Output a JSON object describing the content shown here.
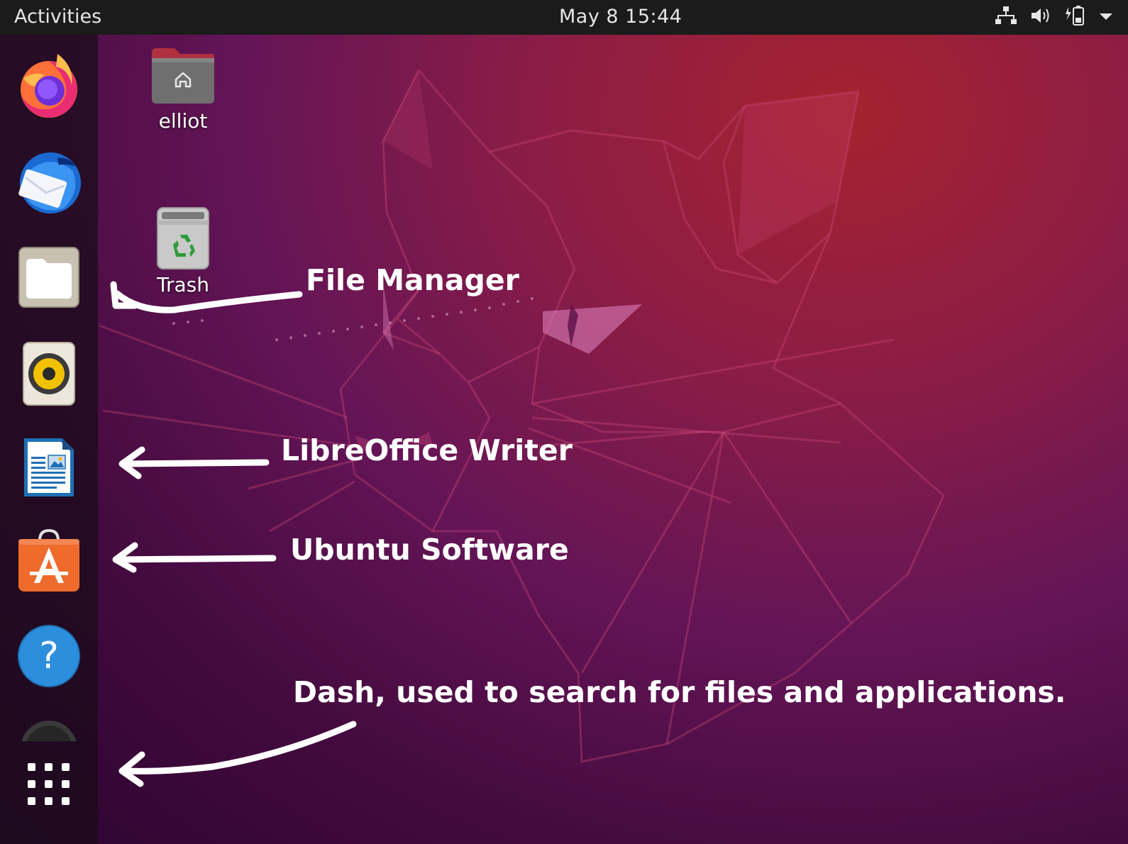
{
  "topbar": {
    "activities_label": "Activities",
    "clock": "May 8  15:44",
    "tray_icons": [
      "network-icon",
      "volume-icon",
      "battery-icon",
      "system-menu-arrow-icon"
    ]
  },
  "dock": {
    "items": [
      {
        "name": "Firefox",
        "icon": "firefox-icon"
      },
      {
        "name": "Thunderbird",
        "icon": "thunderbird-icon"
      },
      {
        "name": "Files",
        "icon": "files-icon"
      },
      {
        "name": "Rhythmbox",
        "icon": "rhythmbox-icon"
      },
      {
        "name": "LibreOffice Writer",
        "icon": "writer-icon"
      },
      {
        "name": "Ubuntu Software",
        "icon": "software-icon"
      },
      {
        "name": "Help",
        "icon": "help-icon"
      },
      {
        "name": "Show Applications",
        "icon": "app-grid-icon"
      }
    ]
  },
  "desktop": {
    "icons": [
      {
        "label": "elliot",
        "icon": "home-folder-icon"
      },
      {
        "label": "Trash",
        "icon": "trash-icon"
      }
    ]
  },
  "annotations": {
    "file_manager": "File Manager",
    "writer": "LibreOffice Writer",
    "software": "Ubuntu Software",
    "dash": "Dash, used to search for files and applications."
  },
  "colors": {
    "topbar": "#1b1b1b",
    "wallpaper_top": "#a5222f",
    "wallpaper_bottom": "#2c0530",
    "software_orange": "#ef6b2c",
    "help_blue": "#2c8fdd"
  }
}
